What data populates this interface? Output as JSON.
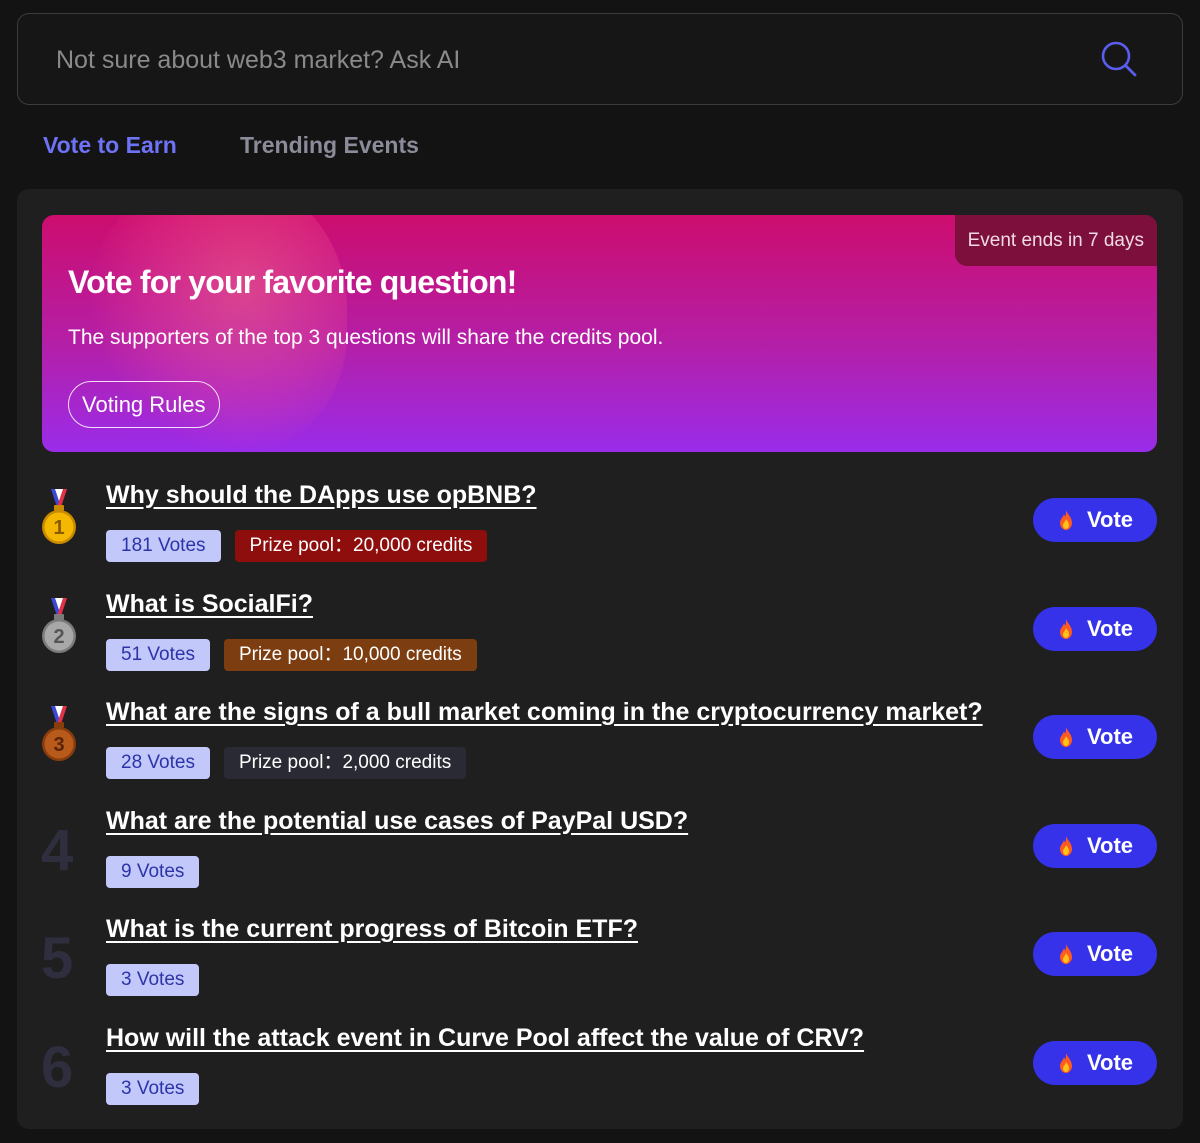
{
  "search": {
    "placeholder": "Not sure about web3 market? Ask AI"
  },
  "tabs": [
    {
      "label": "Vote to Earn",
      "active": true
    },
    {
      "label": "Trending Events",
      "active": false
    }
  ],
  "banner": {
    "badge": "Event ends in 7 days",
    "title": "Vote for your favorite question!",
    "subtitle": "The supporters of the top 3 questions will share the credits pool.",
    "rules_label": "Voting Rules"
  },
  "colors": {
    "accent": "#6e72f5",
    "vote_button": "#3632ea",
    "votes_tag_bg": "#c2c8fa",
    "gold": "#f5b800",
    "silver": "#a8a8a8",
    "bronze": "#b85a1c"
  },
  "questions": [
    {
      "rank": "1",
      "medal": "gold",
      "title": "Why should the DApps use opBNB?",
      "votes": "181 Votes",
      "prize": "Prize pool：20,000 credits",
      "prize_color": "#8e0e0e",
      "vote_label": "Vote"
    },
    {
      "rank": "2",
      "medal": "silver",
      "title": "What is SocialFi?",
      "votes": "51 Votes",
      "prize": "Prize pool：10,000 credits",
      "prize_color": "#7c3d10",
      "vote_label": "Vote"
    },
    {
      "rank": "3",
      "medal": "bronze",
      "title": "What are the signs of a bull market coming in the cryptocurrency market?",
      "votes": "28 Votes",
      "prize": "Prize pool：2,000 credits",
      "prize_color": "#2a2a35",
      "vote_label": "Vote"
    },
    {
      "rank": "4",
      "medal": null,
      "title": "What are the potential use cases of PayPal USD?",
      "votes": "9 Votes",
      "prize": null,
      "prize_color": null,
      "vote_label": "Vote"
    },
    {
      "rank": "5",
      "medal": null,
      "title": "What is the current progress of Bitcoin ETF?",
      "votes": "3 Votes",
      "prize": null,
      "prize_color": null,
      "vote_label": "Vote"
    },
    {
      "rank": "6",
      "medal": null,
      "title": "How will the attack event in Curve Pool affect the value of CRV?",
      "votes": "3 Votes",
      "prize": null,
      "prize_color": null,
      "vote_label": "Vote"
    }
  ]
}
